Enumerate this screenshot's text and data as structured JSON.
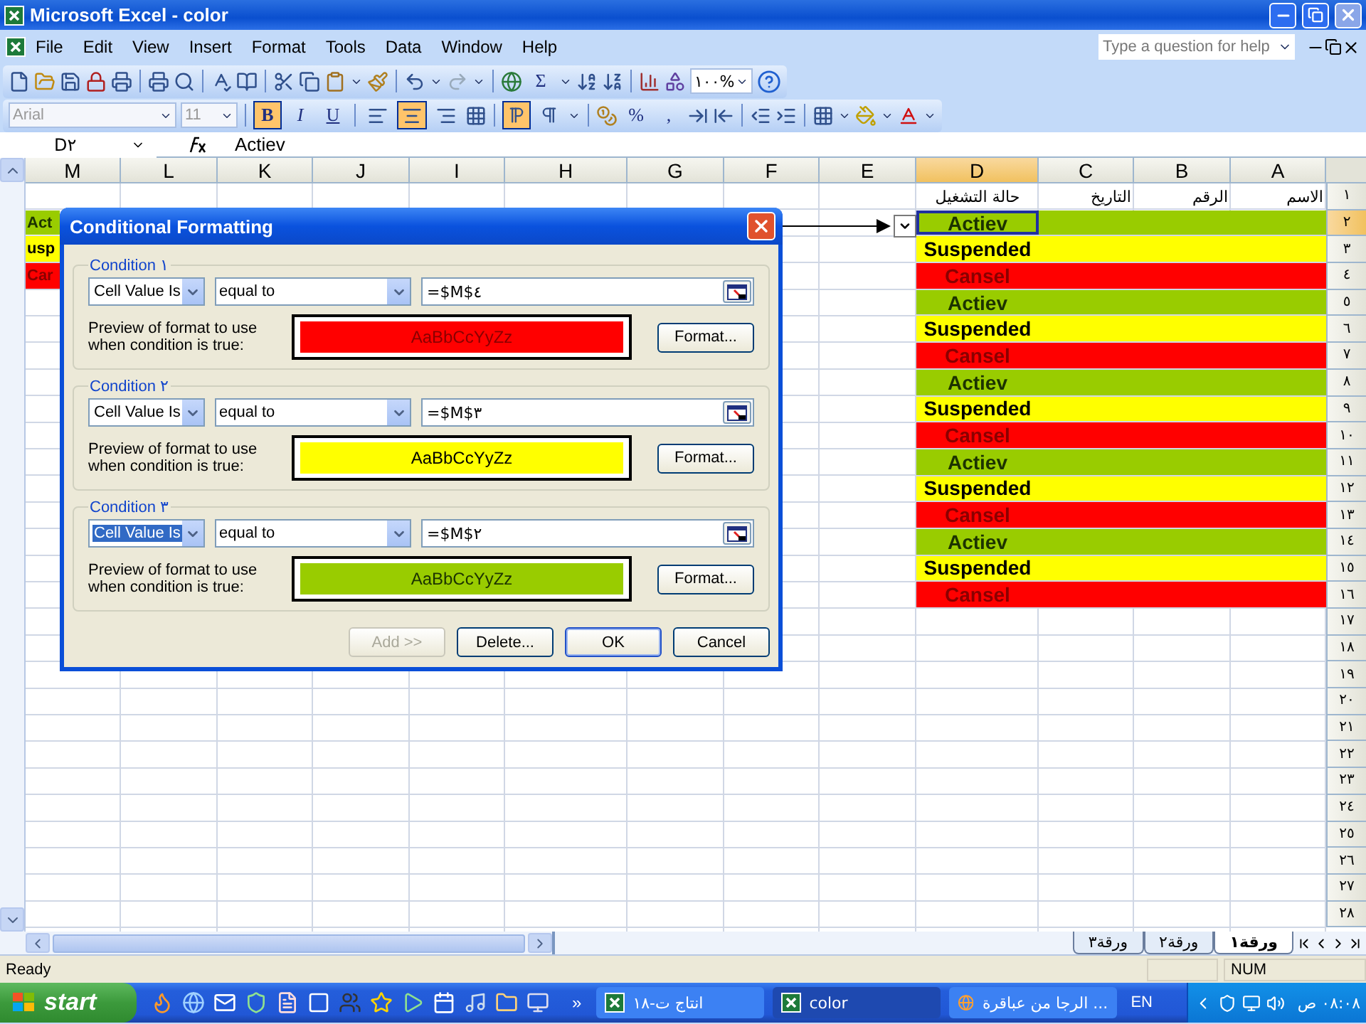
{
  "window": {
    "title": "Microsoft Excel - color"
  },
  "menu": {
    "items": [
      "File",
      "Edit",
      "View",
      "Insert",
      "Format",
      "Tools",
      "Data",
      "Window",
      "Help"
    ],
    "help_search": {
      "placeholder": "Type a question for help"
    }
  },
  "standard_toolbar": {
    "autosum": "Σ",
    "zoom": "١٠٠%"
  },
  "formatting_toolbar": {
    "font": "Arial",
    "size": "11",
    "styles": [
      {
        "label": "B",
        "selected": true
      },
      {
        "label": "I",
        "selected": false
      },
      {
        "label": "U",
        "selected": false
      }
    ],
    "alignment": [
      {
        "kind": "left",
        "selected": false
      },
      {
        "kind": "center",
        "selected": true
      },
      {
        "kind": "right",
        "selected": false
      }
    ],
    "direction": [
      {
        "kind": "right-to-left",
        "selected": true
      },
      {
        "kind": "left-to-right",
        "selected": false
      }
    ],
    "percent": "%",
    "comma": ","
  },
  "formula_bar": {
    "name_box": "D٢",
    "formula": "Actiev"
  },
  "sheet": {
    "columns": [
      {
        "label": "M",
        "selected": false
      },
      {
        "label": "L",
        "selected": false
      },
      {
        "label": "K",
        "selected": false
      },
      {
        "label": "J",
        "selected": false
      },
      {
        "label": "I",
        "selected": false
      },
      {
        "label": "H",
        "selected": false
      },
      {
        "label": "G",
        "selected": false
      },
      {
        "label": "F",
        "selected": false
      },
      {
        "label": "E",
        "selected": false
      },
      {
        "label": "D",
        "selected": true
      },
      {
        "label": "C",
        "selected": false
      },
      {
        "label": "B",
        "selected": false
      },
      {
        "label": "A",
        "selected": false
      }
    ],
    "rows": [
      {
        "number": "١",
        "selected": false,
        "headers": [
          "الاسم",
          "الرقم",
          "التاريخ",
          "حالة التشغيل"
        ]
      },
      {
        "number": "٢",
        "selected": true,
        "m_cell": {
          "text": "Act",
          "color": "#99cc00",
          "kind": "active"
        },
        "status": {
          "text": "Actiev",
          "color": "#99cc00",
          "kind": "active"
        }
      },
      {
        "number": "٣",
        "selected": false,
        "m_cell": {
          "text": "usp",
          "color": "#ffff00",
          "kind": "suspended"
        },
        "status": {
          "text": "Suspended",
          "color": "#ffff00",
          "kind": "suspended"
        }
      },
      {
        "number": "٤",
        "selected": false,
        "m_cell": {
          "text": "Car",
          "color": "#ff0000",
          "kind": "cancelled"
        },
        "status": {
          "text": "Cansel",
          "color": "#ff0000",
          "kind": "cancelled"
        }
      },
      {
        "number": "٥",
        "selected": false,
        "status": {
          "text": "Actiev",
          "color": "#99cc00",
          "kind": "active"
        }
      },
      {
        "number": "٦",
        "selected": false,
        "status": {
          "text": "Suspended",
          "color": "#ffff00",
          "kind": "suspended"
        }
      },
      {
        "number": "٧",
        "selected": false,
        "status": {
          "text": "Cansel",
          "color": "#ff0000",
          "kind": "cancelled"
        }
      },
      {
        "number": "٨",
        "selected": false,
        "status": {
          "text": "Actiev",
          "color": "#99cc00",
          "kind": "active"
        }
      },
      {
        "number": "٩",
        "selected": false,
        "status": {
          "text": "Suspended",
          "color": "#ffff00",
          "kind": "suspended"
        }
      },
      {
        "number": "١٠",
        "selected": false,
        "status": {
          "text": "Cansel",
          "color": "#ff0000",
          "kind": "cancelled"
        }
      },
      {
        "number": "١١",
        "selected": false,
        "status": {
          "text": "Actiev",
          "color": "#99cc00",
          "kind": "active"
        }
      },
      {
        "number": "١٢",
        "selected": false,
        "status": {
          "text": "Suspended",
          "color": "#ffff00",
          "kind": "suspended"
        }
      },
      {
        "number": "١٣",
        "selected": false,
        "status": {
          "text": "Cansel",
          "color": "#ff0000",
          "kind": "cancelled"
        }
      },
      {
        "number": "١٤",
        "selected": false,
        "status": {
          "text": "Actiev",
          "color": "#99cc00",
          "kind": "active"
        }
      },
      {
        "number": "١٥",
        "selected": false,
        "status": {
          "text": "Suspended",
          "color": "#ffff00",
          "kind": "suspended"
        }
      },
      {
        "number": "١٦",
        "selected": false,
        "status": {
          "text": "Cansel",
          "color": "#ff0000",
          "kind": "cancelled"
        }
      },
      {
        "number": "١٧",
        "selected": false
      },
      {
        "number": "١٨",
        "selected": false
      },
      {
        "number": "١٩",
        "selected": false
      },
      {
        "number": "٢٠",
        "selected": false
      },
      {
        "number": "٢١",
        "selected": false
      },
      {
        "number": "٢٢",
        "selected": false
      },
      {
        "number": "٢٣",
        "selected": false
      },
      {
        "number": "٢٤",
        "selected": false
      },
      {
        "number": "٢٥",
        "selected": false
      },
      {
        "number": "٢٦",
        "selected": false
      },
      {
        "number": "٢٧",
        "selected": false
      },
      {
        "number": "٢٨",
        "selected": false
      }
    ]
  },
  "dialog": {
    "title": "Conditional Formatting",
    "conditions": [
      {
        "legend": "Condition ١",
        "type": "Cell Value Is",
        "type_focused": false,
        "operator": "equal to",
        "formula": "=$M$٤",
        "preview_label": "Preview of format to use when condition is true:",
        "preview": "AaBbCcYyZz",
        "color": "#ff0000",
        "kind": "cancelled",
        "format_button": "Format..."
      },
      {
        "legend": "Condition ٢",
        "type": "Cell Value Is",
        "type_focused": false,
        "operator": "equal to",
        "formula": "=$M$٣",
        "preview_label": "Preview of format to use when condition is true:",
        "preview": "AaBbCcYyZz",
        "color": "#ffff00",
        "kind": "suspended",
        "format_button": "Format..."
      },
      {
        "legend": "Condition ٣",
        "type": "Cell Value Is",
        "type_focused": true,
        "operator": "equal to",
        "formula": "=$M$٢",
        "preview_label": "Preview of format to use when condition is true:",
        "preview": "AaBbCcYyZz",
        "color": "#99cc00",
        "kind": "active",
        "format_button": "Format..."
      }
    ],
    "buttons": [
      {
        "label": "Add >>",
        "disabled": true,
        "default": false
      },
      {
        "label": "Delete...",
        "disabled": false,
        "default": false
      },
      {
        "label": "OK",
        "disabled": false,
        "default": true
      },
      {
        "label": "Cancel",
        "disabled": false,
        "default": false
      }
    ]
  },
  "sheet_tabs": [
    {
      "label": "ورقة١",
      "selected": true
    },
    {
      "label": "ورقة٢",
      "selected": false
    },
    {
      "label": "ورقة٣",
      "selected": false
    }
  ],
  "status_bar": {
    "status": "Ready",
    "indicator": "NUM"
  },
  "taskbar": {
    "start": "start",
    "more": "»",
    "tasks": [
      {
        "label": "الرجا من عباقرة ...",
        "selected": false,
        "kind": "browser"
      },
      {
        "label": "color",
        "selected": true,
        "kind": "excel"
      },
      {
        "label": "انتاج ت-١٨",
        "selected": false,
        "kind": "excel"
      }
    ],
    "language": "EN",
    "clock": "٠٨:٠٨ ص"
  }
}
